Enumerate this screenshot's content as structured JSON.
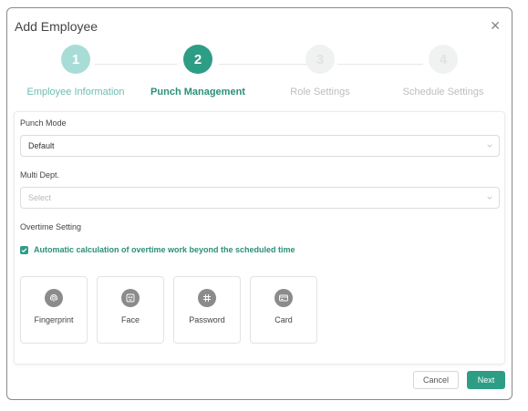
{
  "dialog": {
    "title": "Add Employee",
    "close_icon": "close-icon"
  },
  "steps": [
    {
      "number": "1",
      "label": "Employee Information",
      "state": "completed"
    },
    {
      "number": "2",
      "label": "Punch Management",
      "state": "active"
    },
    {
      "number": "3",
      "label": "Role Settings",
      "state": "pending"
    },
    {
      "number": "4",
      "label": "Schedule Settings",
      "state": "pending"
    }
  ],
  "form": {
    "punch_mode": {
      "label": "Punch Mode",
      "value": "Default"
    },
    "multi_dept": {
      "label": "Multi Dept.",
      "placeholder": "Select"
    },
    "overtime": {
      "label": "Overtime Setting",
      "checkbox_label": "Automatic calculation of overtime work beyond the scheduled time",
      "checked": true
    }
  },
  "methods": [
    {
      "label": "Fingerprint",
      "icon": "fingerprint-icon"
    },
    {
      "label": "Face",
      "icon": "face-icon"
    },
    {
      "label": "Password",
      "icon": "password-icon"
    },
    {
      "label": "Card",
      "icon": "card-icon"
    }
  ],
  "footer": {
    "cancel_label": "Cancel",
    "next_label": "Next"
  },
  "colors": {
    "accent": "#2e9d86",
    "completed": "#a8ddd7",
    "pending": "#f0f2f2"
  }
}
